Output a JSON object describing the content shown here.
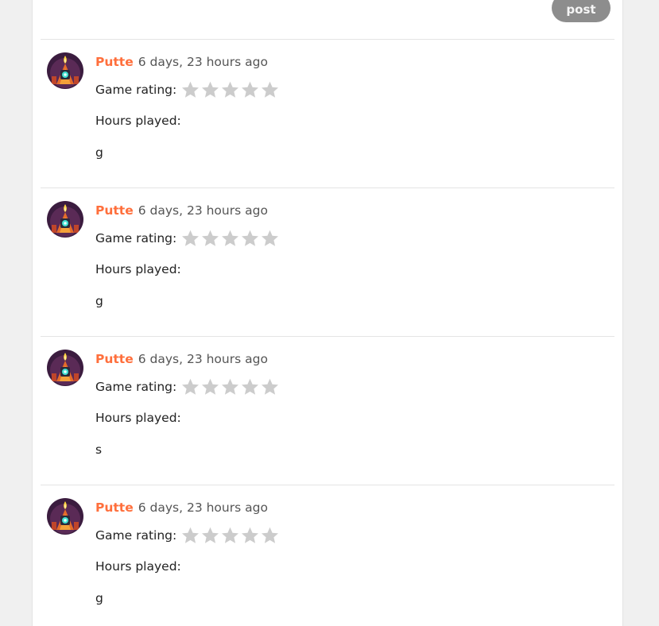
{
  "post_button": {
    "label": "post"
  },
  "comments": [
    {
      "author": "Putte",
      "time": "6 days, 23 hours ago",
      "rating_label": "Game rating:",
      "rating": 0,
      "rating_max": 5,
      "hours_label": "Hours played:",
      "hours_value": "",
      "text": "g"
    },
    {
      "author": "Putte",
      "time": "6 days, 23 hours ago",
      "rating_label": "Game rating:",
      "rating": 0,
      "rating_max": 5,
      "hours_label": "Hours played:",
      "hours_value": "",
      "text": "g"
    },
    {
      "author": "Putte",
      "time": "6 days, 23 hours ago",
      "rating_label": "Game rating:",
      "rating": 0,
      "rating_max": 5,
      "hours_label": "Hours played:",
      "hours_value": "",
      "text": "s"
    },
    {
      "author": "Putte",
      "time": "6 days, 23 hours ago",
      "rating_label": "Game rating:",
      "rating": 0,
      "rating_max": 5,
      "hours_label": "Hours played:",
      "hours_value": "",
      "text": "g"
    }
  ],
  "colors": {
    "author": "#ff6f3c",
    "star_empty": "#cccccc",
    "star_filled": "#f5b301",
    "button": "#8d8d8d"
  },
  "icons": {
    "avatar": "robot-avatar-icon",
    "star": "star-icon"
  }
}
